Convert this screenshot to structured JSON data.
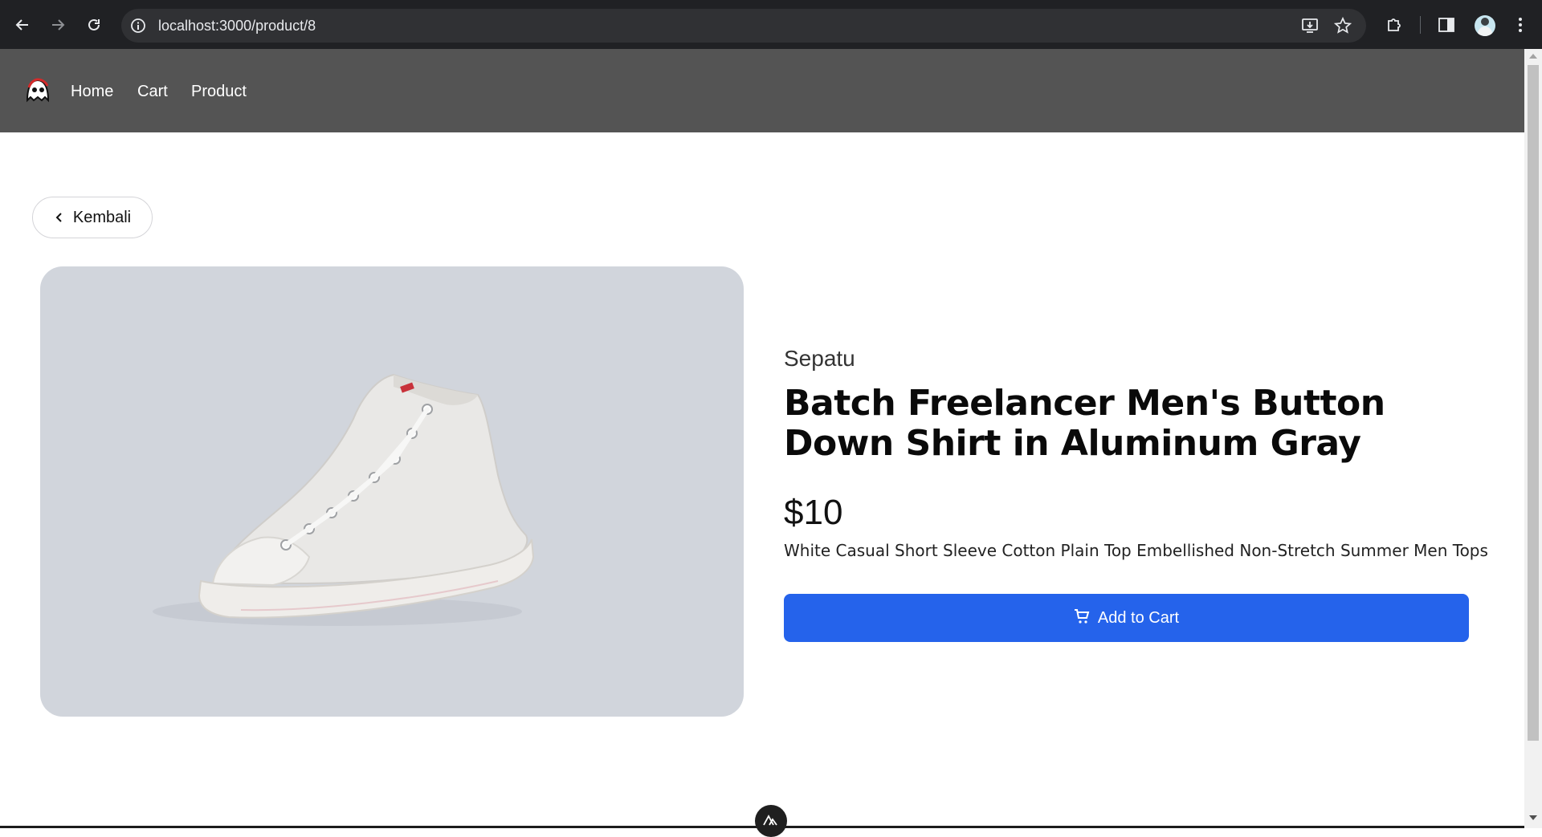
{
  "browser": {
    "url": "localhost:3000/product/8",
    "icons": [
      "back-arrow-icon",
      "forward-arrow-icon",
      "reload-icon",
      "site-info-icon",
      "install-app-icon",
      "bookmark-star-icon",
      "extensions-icon",
      "side-panel-icon",
      "profile-avatar",
      "menu-kebab-icon"
    ]
  },
  "navbar": {
    "links": [
      {
        "label": "Home"
      },
      {
        "label": "Cart"
      },
      {
        "label": "Product"
      }
    ],
    "bg_color": "#545454"
  },
  "back_button": {
    "label": "Kembali",
    "icon": "chevron-left-icon"
  },
  "product": {
    "category": "Sepatu",
    "title": "Batch Freelancer Men's Button Down Shirt in Aluminum Gray",
    "price": "$10",
    "description": "White Casual Short Sleeve Cotton Plain Top Embellished Non-Stretch Summer Men Tops",
    "image_bg": "#d1d5dc",
    "image_subject": "white-high-top-sneaker"
  },
  "cart_button": {
    "label": "Add to Cart",
    "icon": "shopping-cart-icon",
    "color": "#2563eb"
  }
}
